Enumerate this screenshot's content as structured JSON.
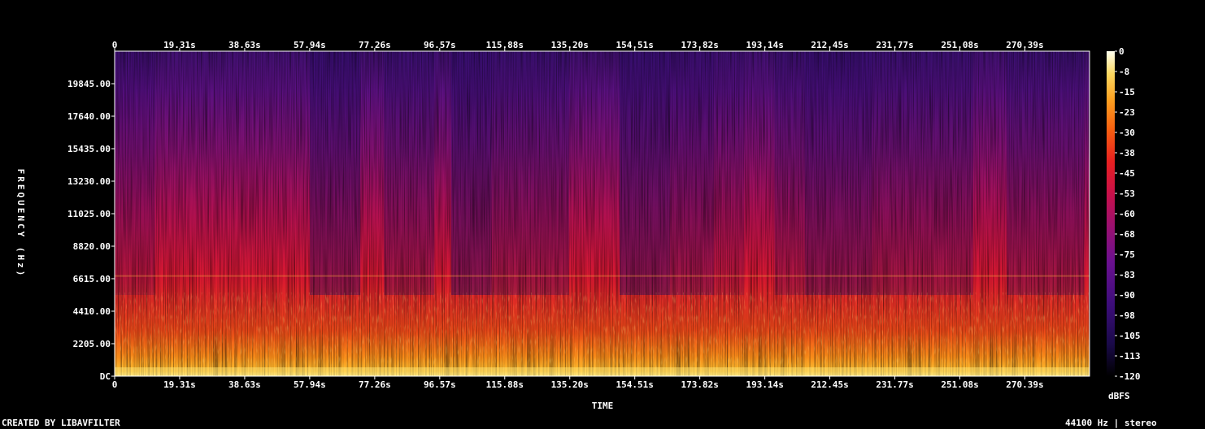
{
  "chart_data": {
    "type": "heatmap",
    "subtype": "spectrogram",
    "xlabel": "TIME",
    "ylabel": "FREQUENCY (Hz)",
    "x_tick_labels": [
      "0",
      "19.31s",
      "38.63s",
      "57.94s",
      "77.26s",
      "96.57s",
      "115.88s",
      "135.20s",
      "154.51s",
      "173.82s",
      "193.14s",
      "212.45s",
      "231.77s",
      "251.08s",
      "270.39s"
    ],
    "x_ticks_seconds": [
      0,
      19.31,
      38.63,
      57.94,
      77.26,
      96.57,
      115.88,
      135.2,
      154.51,
      173.82,
      193.14,
      212.45,
      231.77,
      251.08,
      270.39
    ],
    "xlim": [
      0,
      289.6
    ],
    "y_tick_labels": [
      "DC",
      "2205.00",
      "4410.00",
      "6615.00",
      "8820.00",
      "11025.00",
      "13230.00",
      "15435.00",
      "17640.00",
      "19845.00"
    ],
    "y_ticks_hz": [
      0,
      2205,
      4410,
      6615,
      8820,
      11025,
      13230,
      15435,
      17640,
      19845
    ],
    "ylim": [
      0,
      22050
    ],
    "colorbar": {
      "label": "dBFS",
      "tick_labels": [
        "0",
        "-8",
        "-15",
        "-23",
        "-30",
        "-38",
        "-45",
        "-53",
        "-60",
        "-68",
        "-75",
        "-83",
        "-90",
        "-98",
        "-105",
        "-113",
        "-120"
      ],
      "range": [
        -120,
        0
      ],
      "colors": [
        "#000000",
        "#1a0a4a",
        "#3c0d7a",
        "#6a1090",
        "#9a1070",
        "#c8104a",
        "#e82020",
        "#f86010",
        "#fca020",
        "#fcd860",
        "#fffff0"
      ]
    },
    "grid": false,
    "legend": "colorbar-right"
  },
  "footer": {
    "credit": "CREATED BY LIBAVFILTER",
    "format": "44100 Hz | stereo"
  }
}
